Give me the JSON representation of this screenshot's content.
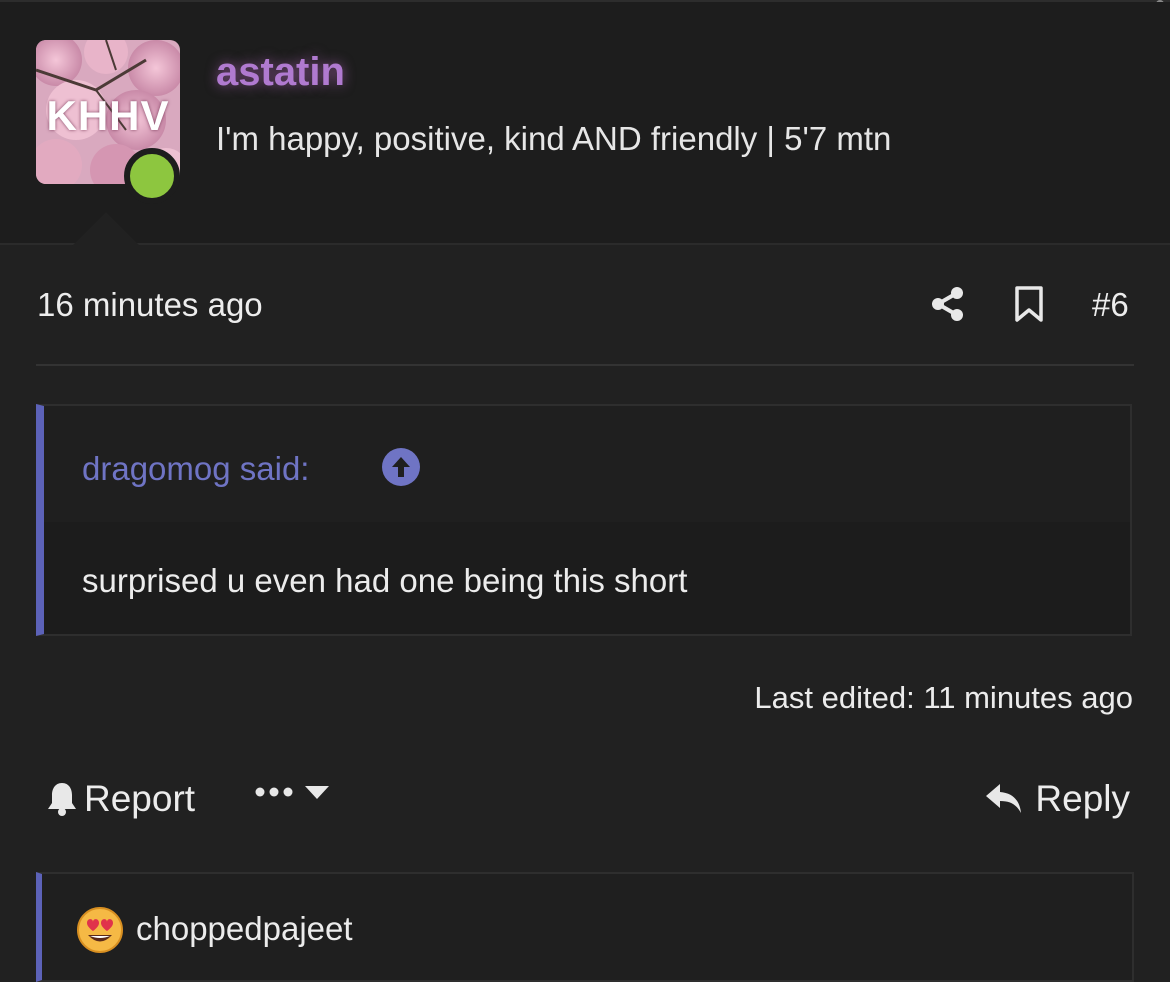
{
  "header": {
    "avatar_text": "KHHV",
    "username": "astatin",
    "tagline": "I'm happy, positive, kind AND friendly | 5'7 mtn"
  },
  "post": {
    "time": "16 minutes ago",
    "number": "#6",
    "quote": {
      "author": "dragomog said:",
      "text": "surprised u even had one being this short"
    },
    "last_edited": "Last edited: 11 minutes ago"
  },
  "actions": {
    "report_label": "Report",
    "reply_label": "Reply"
  },
  "reactions": {
    "user": "choppedpajeet",
    "emoji_icon": "heart-eyes-emoji-icon"
  },
  "colors": {
    "background": "#212121",
    "username": "#b07ad0",
    "quote_accent": "#5c62b8",
    "online": "#8dc63f"
  }
}
